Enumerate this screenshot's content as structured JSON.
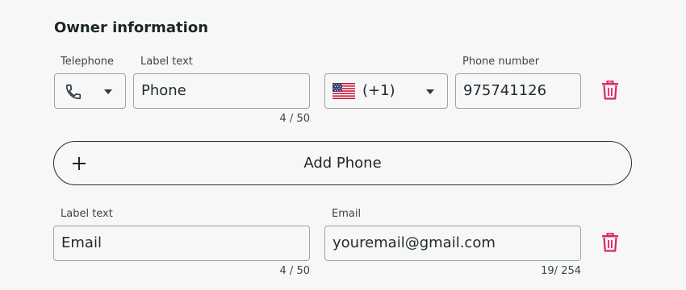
{
  "section": {
    "title": "Owner information"
  },
  "phone_row": {
    "type_label": "Telephone",
    "type_icon": "phone-icon",
    "label_field_label": "Label text",
    "label_value": "Phone",
    "label_counter": "4 / 50",
    "country_flag_icon": "us-flag-icon",
    "country_code": "(+1)",
    "phone_number_label": "Phone number",
    "phone_number_value": "975741126",
    "delete_icon": "trash-icon"
  },
  "add_phone": {
    "label": "Add Phone",
    "icon": "plus-icon"
  },
  "email_row": {
    "label_field_label": "Label text",
    "label_value": "Email",
    "label_counter": "4 / 50",
    "email_label": "Email",
    "email_value": "youremail@gmail.com",
    "email_counter": "19/ 254",
    "delete_icon": "trash-icon"
  },
  "colors": {
    "background": "#f7f7f7",
    "field_border": "#93a7b0",
    "danger": "#e0245e",
    "text": "#1f2a30"
  }
}
